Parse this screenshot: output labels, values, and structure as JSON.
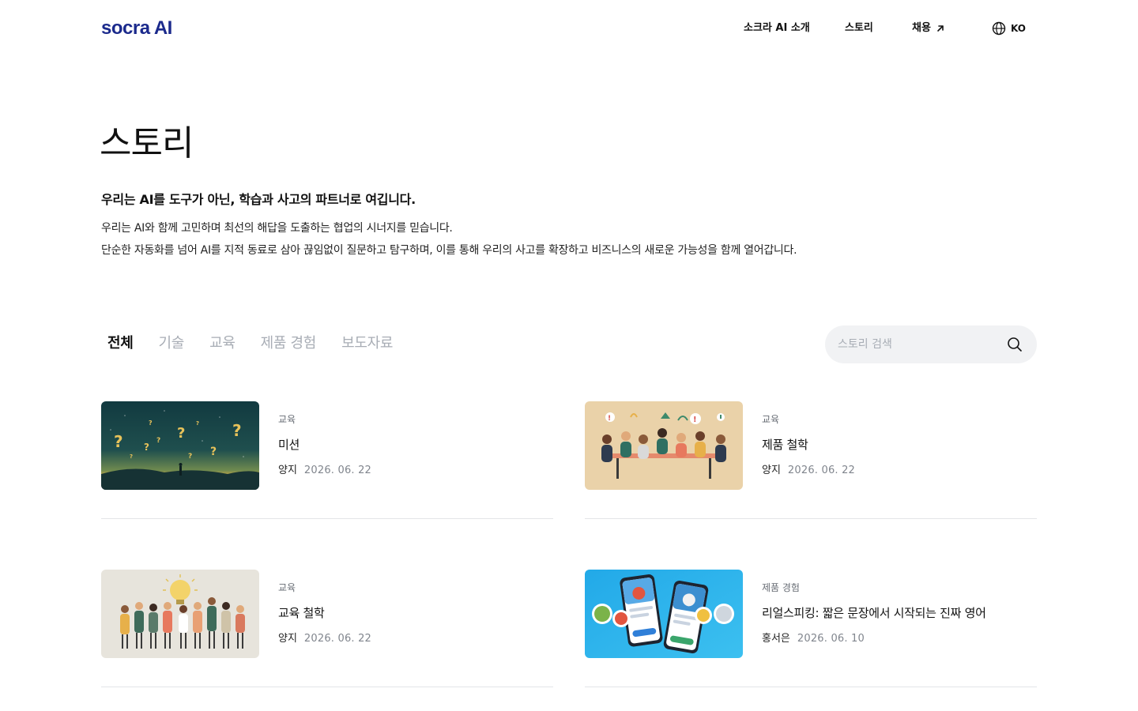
{
  "brand": {
    "logo_text": "socra AI",
    "color": "#1b2a8c"
  },
  "nav": {
    "about": "소크라 AI 소개",
    "story": "스토리",
    "jobs": "채용",
    "language": "KO"
  },
  "intro": {
    "title": "스토리",
    "lead": "우리는 AI를 도구가 아닌, 학습과 사고의 파트너로 여깁니다.",
    "line1": "우리는 AI와 함께 고민하며 최선의 해답을 도출하는 협업의 시너지를 믿습니다.",
    "line2": "단순한 자동화를 넘어 AI를 지적 동료로 삼아 끊임없이 질문하고 탐구하며, 이를 통해 우리의 사고를 확장하고 비즈니스의 새로운 가능성을 함께 열어갑니다."
  },
  "tabs": [
    {
      "label": "전체",
      "active": true
    },
    {
      "label": "기술",
      "active": false
    },
    {
      "label": "교육",
      "active": false
    },
    {
      "label": "제품 경험",
      "active": false
    },
    {
      "label": "보도자료",
      "active": false
    }
  ],
  "search": {
    "placeholder": "스토리 검색",
    "value": ""
  },
  "stories": [
    {
      "category": "교육",
      "title": "미션",
      "author": "양지",
      "date": "2026. 06. 22",
      "image": "question-marks-night-sky"
    },
    {
      "category": "교육",
      "title": "제품 철학",
      "author": "양지",
      "date": "2026. 06. 22",
      "image": "team-meeting-table"
    },
    {
      "category": "교육",
      "title": "교육 철학",
      "author": "양지",
      "date": "2026. 06. 22",
      "image": "crowd-lightbulb"
    },
    {
      "category": "제품 경험",
      "title": "리얼스피킹: 짧은 문장에서 시작되는 진짜 영어",
      "author": "홍서은",
      "date": "2026. 06. 10",
      "image": "phones-app-screens"
    }
  ]
}
